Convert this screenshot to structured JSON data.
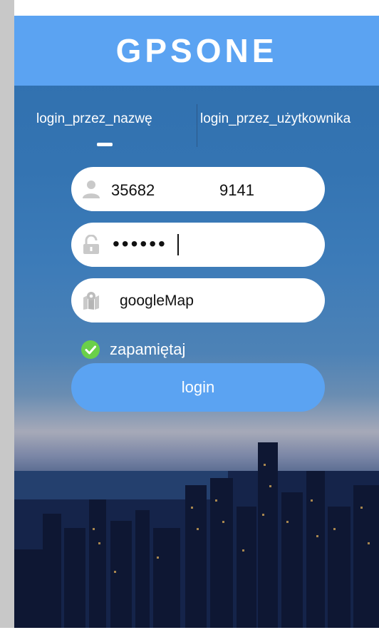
{
  "app": {
    "title": "GPSONE"
  },
  "tabs": [
    {
      "label": "login_przez_nazwę",
      "active": true
    },
    {
      "label": "login_przez_użytkownika",
      "active": false
    }
  ],
  "form": {
    "username_part1": "35682",
    "username_part2": "9141",
    "password_masked": "••••••",
    "map_type": "googleMap",
    "remember_label": "zapamiętaj",
    "remember_checked": true,
    "login_label": "login"
  },
  "icons": {
    "username": "user-icon",
    "password": "lock-icon",
    "map": "map-pin-icon",
    "remember": "check-circle-icon"
  },
  "colors": {
    "header_bg": "#5ba3f2",
    "button_bg": "#5ba3f2",
    "check_green": "#6ad04a",
    "icon_grey": "#c9c9c9"
  }
}
